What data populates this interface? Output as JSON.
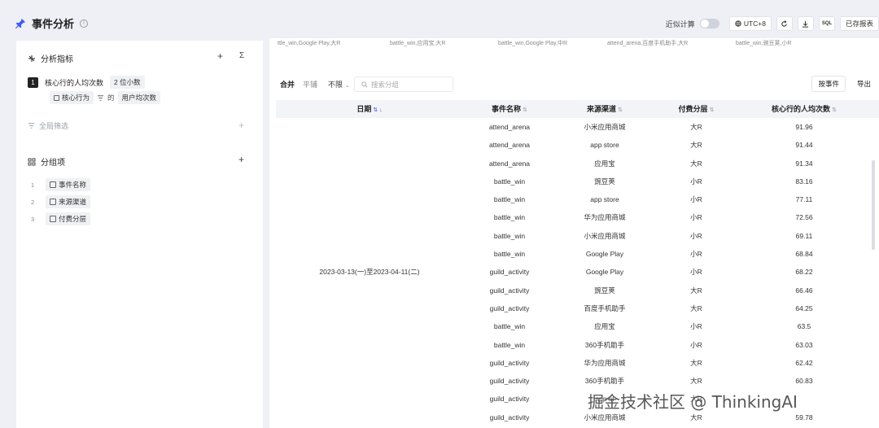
{
  "header": {
    "title": "事件分析",
    "info_icon": "info-icon",
    "approx_label": "近似计算",
    "approx_enabled": false,
    "timezone_label": "UTC+8",
    "sql_label": "SQL",
    "saved_reports_label": "已存报表"
  },
  "left_panel": {
    "metrics": {
      "title": "分析指标",
      "plus": "+",
      "sigma": "Σ",
      "items": [
        {
          "index": "1",
          "name": "核心行的人均次数",
          "precision": "2 位小数",
          "event": "核心行为",
          "connector": "的",
          "aggregate": "用户均次数"
        }
      ]
    },
    "global_filter": {
      "label": "全局筛选",
      "plus": "+"
    },
    "group_by": {
      "title": "分组项",
      "plus": "+",
      "items": [
        {
          "index": "1",
          "label": "事件名称"
        },
        {
          "index": "2",
          "label": "来源渠道"
        },
        {
          "index": "3",
          "label": "付费分层"
        }
      ]
    }
  },
  "series_legend": [
    "ttle_win,Google Play,大R",
    "battle_win,应用宝,大R",
    "battle_win,Google Play,中R",
    "attend_arena,百度手机助手,大R",
    "battle_win,豌豆荚,小R"
  ],
  "controls": {
    "view_modes": [
      "合并",
      "平铺"
    ],
    "active_view": "合并",
    "limit_value": "不限",
    "search_placeholder": "搜索分组",
    "by_event_label": "按事件",
    "export_label": "导出"
  },
  "table": {
    "columns": [
      "日期",
      "事件名称",
      "来源渠道",
      "付费分层",
      "核心行的人均次数"
    ],
    "date_range": "2023-03-13(一)至2023-04-11(二)",
    "rows": [
      {
        "event": "attend_arena",
        "channel": "小米应用商城",
        "tier": "大R",
        "value": "91.96"
      },
      {
        "event": "attend_arena",
        "channel": "app store",
        "tier": "大R",
        "value": "91.44"
      },
      {
        "event": "attend_arena",
        "channel": "应用宝",
        "tier": "大R",
        "value": "91.34"
      },
      {
        "event": "battle_win",
        "channel": "豌豆荚",
        "tier": "小R",
        "value": "83.16"
      },
      {
        "event": "battle_win",
        "channel": "app store",
        "tier": "小R",
        "value": "77.11"
      },
      {
        "event": "battle_win",
        "channel": "华为应用商城",
        "tier": "小R",
        "value": "72.56"
      },
      {
        "event": "battle_win",
        "channel": "小米应用商城",
        "tier": "小R",
        "value": "69.11"
      },
      {
        "event": "battle_win",
        "channel": "Google Play",
        "tier": "小R",
        "value": "68.84"
      },
      {
        "event": "guild_activity",
        "channel": "Google Play",
        "tier": "小R",
        "value": "68.22"
      },
      {
        "event": "guild_activity",
        "channel": "豌豆荚",
        "tier": "大R",
        "value": "66.46"
      },
      {
        "event": "guild_activity",
        "channel": "百度手机助手",
        "tier": "大R",
        "value": "64.25"
      },
      {
        "event": "battle_win",
        "channel": "应用宝",
        "tier": "小R",
        "value": "63.5"
      },
      {
        "event": "battle_win",
        "channel": "360手机助手",
        "tier": "小R",
        "value": "63.03"
      },
      {
        "event": "guild_activity",
        "channel": "华为应用商城",
        "tier": "大R",
        "value": "62.42"
      },
      {
        "event": "guild_activity",
        "channel": "360手机助手",
        "tier": "大R",
        "value": "60.83"
      },
      {
        "event": "guild_activity",
        "channel": "app st",
        "tier": "大R",
        "value": ""
      },
      {
        "event": "guild_activity",
        "channel": "小米应用商城",
        "tier": "大R",
        "value": "59.78"
      }
    ]
  },
  "watermark": "掘金技术社区 @ ThinkingAI",
  "colors": {
    "accent": "#3d5afe",
    "page_bg": "#eef0f5",
    "header_row_bg": "#f3f4f7"
  }
}
